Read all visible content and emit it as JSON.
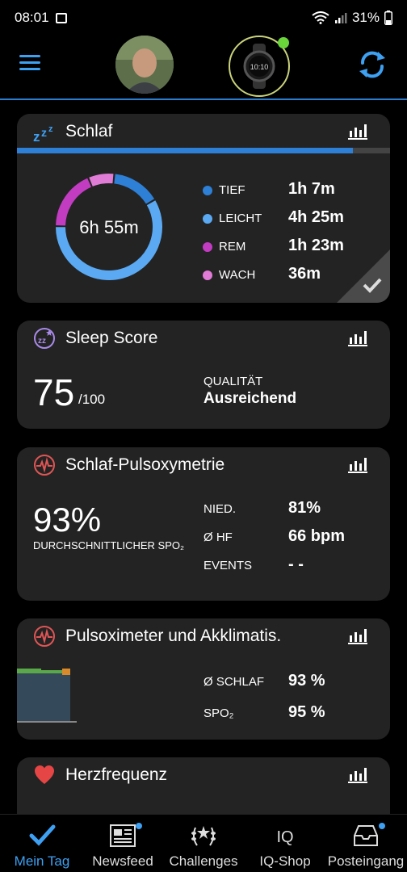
{
  "status": {
    "time": "08:01",
    "battery": "31%"
  },
  "sleep": {
    "title": "Schlaf",
    "total": "6h 55m",
    "legend": [
      {
        "label": "TIEF",
        "value": "1h 7m",
        "color": "#2e7fd6"
      },
      {
        "label": "LEICHT",
        "value": "4h 25m",
        "color": "#5aa9f2"
      },
      {
        "label": "REM",
        "value": "1h 23m",
        "color": "#c13cc1"
      },
      {
        "label": "WACH",
        "value": "36m",
        "color": "#e07bd6"
      }
    ],
    "progress": 0.9
  },
  "sleep_score": {
    "title": "Sleep Score",
    "score": "75",
    "max": "/100",
    "quality_label": "QUALITÄT",
    "quality_value": "Ausreichend"
  },
  "pulse_ox": {
    "title": "Schlaf-Pulsoxymetrie",
    "value": "93%",
    "caption": "DURCHSCHNITTLICHER SPO₂",
    "rows": [
      {
        "label": "NIED.",
        "value": "81%"
      },
      {
        "label": "Ø HF",
        "value": "66 bpm"
      },
      {
        "label": "EVENTS",
        "value": "- -"
      }
    ]
  },
  "acclim": {
    "title": "Pulsoximeter und Akklimatis.",
    "rows": [
      {
        "label": "Ø SCHLAF",
        "value": "93 %"
      },
      {
        "label": "SPO₂",
        "value": "95 %"
      }
    ]
  },
  "heart": {
    "title": "Herzfrequenz"
  },
  "nav": [
    {
      "label": "Mein Tag",
      "icon": "check-icon",
      "active": true
    },
    {
      "label": "Newsfeed",
      "icon": "newspaper-icon"
    },
    {
      "label": "Challenges",
      "icon": "laurel-icon"
    },
    {
      "label": "IQ-Shop",
      "icon": "iq-icon"
    },
    {
      "label": "Posteingang",
      "icon": "inbox-icon"
    }
  ],
  "colors": {
    "accent": "#3ea0f2",
    "card_bg": "#232323"
  }
}
